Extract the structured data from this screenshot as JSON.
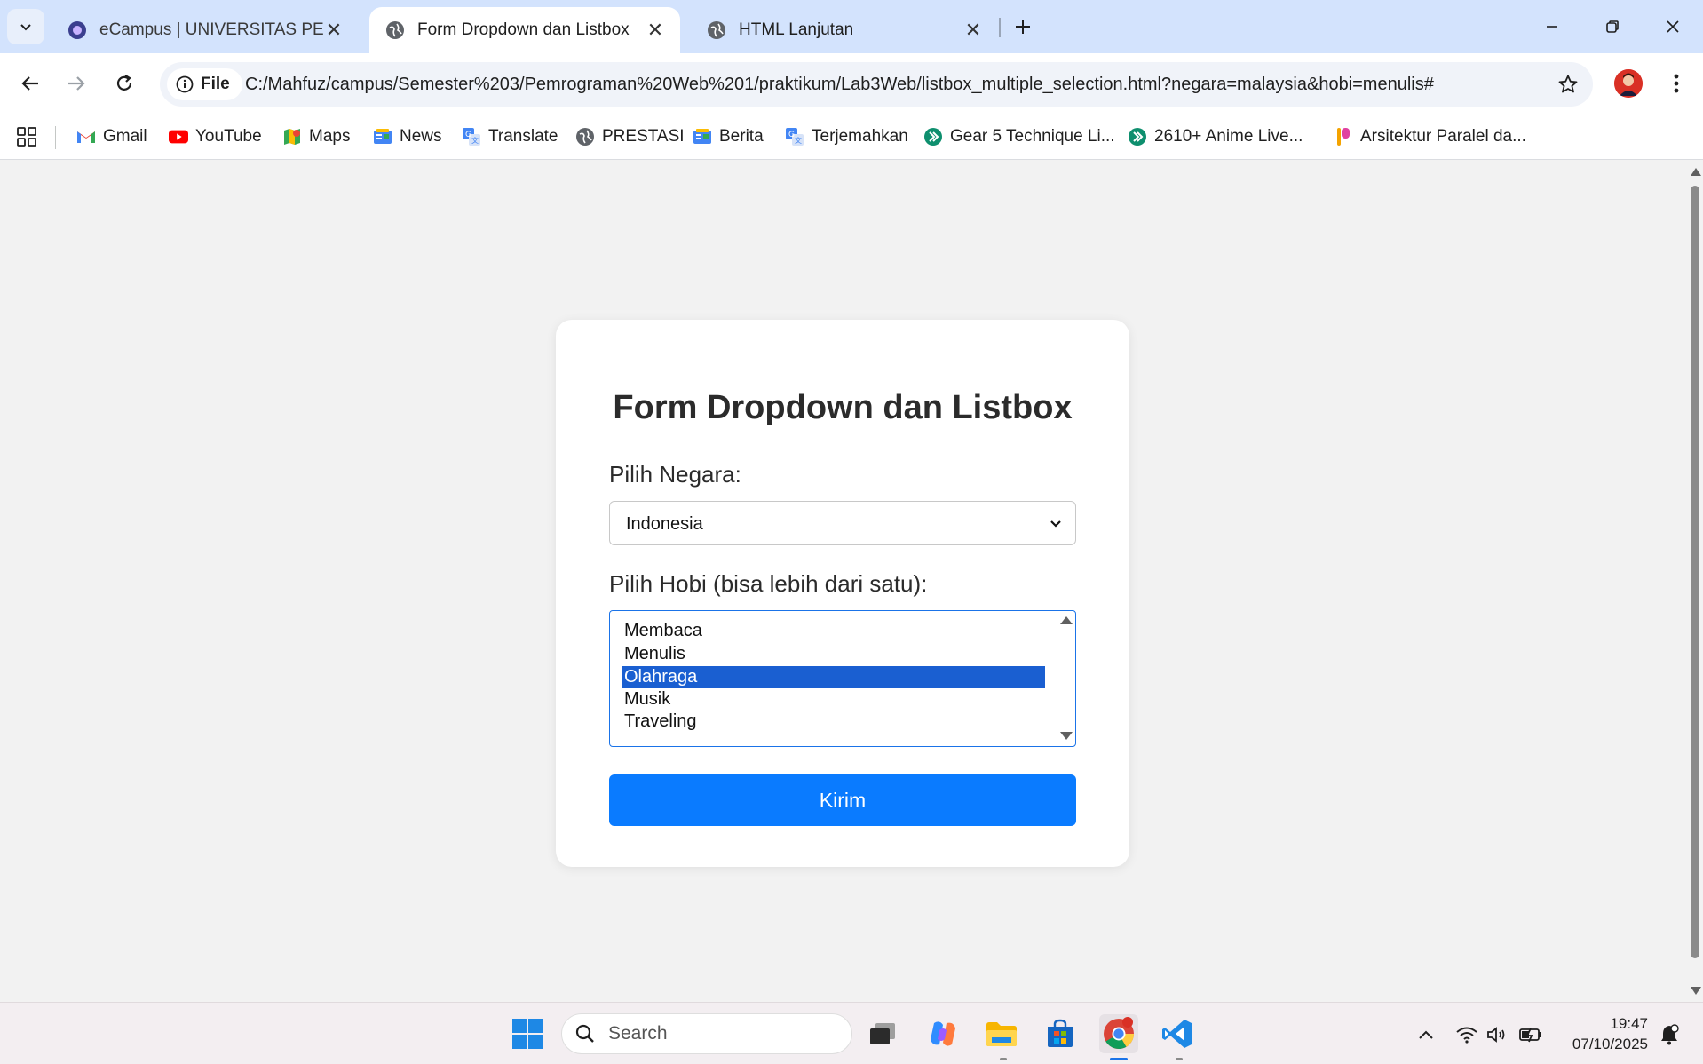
{
  "browser": {
    "tabs": [
      {
        "title": "eCampus | UNIVERSITAS PELITA",
        "active": false
      },
      {
        "title": "Form Dropdown dan Listbox",
        "active": true
      },
      {
        "title": "HTML Lanjutan",
        "active": false
      }
    ],
    "address": {
      "scheme_chip": "File",
      "url": "C:/Mahfuz/campus/Semester%203/Pemrograman%20Web%201/praktikum/Lab3Web/listbox_multiple_selection.html?negara=malaysia&hobi=menulis#"
    },
    "bookmarks": [
      {
        "label": "Gmail",
        "icon": "gmail-icon"
      },
      {
        "label": "YouTube",
        "icon": "youtube-icon"
      },
      {
        "label": "Maps",
        "icon": "maps-icon"
      },
      {
        "label": "News",
        "icon": "news-icon"
      },
      {
        "label": "Translate",
        "icon": "translate-icon"
      },
      {
        "label": "PRESTASI",
        "icon": "globe-icon"
      },
      {
        "label": "Berita",
        "icon": "news-icon"
      },
      {
        "label": "Terjemahkan",
        "icon": "translate-icon"
      },
      {
        "label": "Gear 5 Technique Li...",
        "icon": "arrow-badge-icon"
      },
      {
        "label": "2610+ Anime Live...",
        "icon": "arrow-badge-icon"
      },
      {
        "label": "Arsitektur Paralel da...",
        "icon": "gradient-logo-icon"
      }
    ]
  },
  "form": {
    "title": "Form Dropdown dan Listbox",
    "country_label": "Pilih Negara:",
    "country_selected": "Indonesia",
    "hobby_label": "Pilih Hobi (bisa lebih dari satu):",
    "hobbies": [
      {
        "label": "Membaca",
        "selected": false
      },
      {
        "label": "Menulis",
        "selected": false
      },
      {
        "label": "Olahraga",
        "selected": true
      },
      {
        "label": "Musik",
        "selected": false
      },
      {
        "label": "Traveling",
        "selected": false
      }
    ],
    "submit_label": "Kirim"
  },
  "taskbar": {
    "search_placeholder": "Search",
    "time": "19:47",
    "date": "07/10/2025"
  },
  "colors": {
    "tabbar": "#d3e3fd",
    "button": "#0a7bff",
    "selection": "#1a5fd1"
  }
}
